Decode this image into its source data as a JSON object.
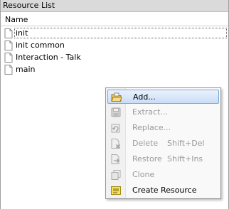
{
  "panel": {
    "title": "Resource List"
  },
  "list": {
    "column_header": "Name",
    "items": [
      {
        "label": "init",
        "selected": true
      },
      {
        "label": "init common"
      },
      {
        "label": "Interaction - Talk"
      },
      {
        "label": "main"
      }
    ]
  },
  "context_menu": {
    "items": [
      {
        "label": "Add...",
        "shortcut": "",
        "enabled": true,
        "icon": "folder-open-icon",
        "hovered": true
      },
      {
        "label": "Extract...",
        "shortcut": "",
        "enabled": false,
        "icon": "save-icon"
      },
      {
        "label": "Replace...",
        "shortcut": "",
        "enabled": false,
        "icon": "replace-icon"
      },
      {
        "label": "Delete",
        "shortcut": "Shift+Del",
        "enabled": false,
        "icon": "delete-icon"
      },
      {
        "label": "Restore",
        "shortcut": "Shift+Ins",
        "enabled": false,
        "icon": "restore-icon"
      },
      {
        "label": "Clone",
        "shortcut": "",
        "enabled": false,
        "icon": "clone-icon"
      },
      {
        "label": "Create Resource",
        "shortcut": "",
        "enabled": true,
        "icon": "new-resource-icon"
      }
    ]
  },
  "colors": {
    "menu_hover": "#c9ddf6",
    "disabled_text": "#9a9a9a",
    "title_bar": "#dadada"
  }
}
